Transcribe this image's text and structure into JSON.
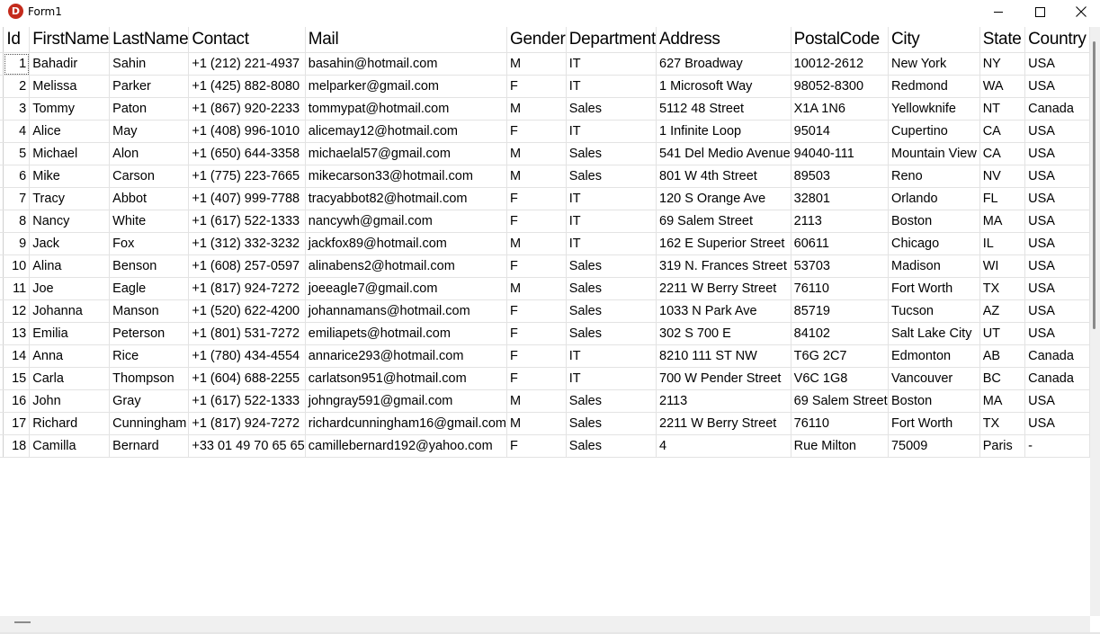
{
  "window": {
    "title": "Form1",
    "app_icon_letter": "D",
    "app_icon_color": "#c42b1c"
  },
  "columns": [
    "Id",
    "FirstName",
    "LastName",
    "Contact",
    "Mail",
    "Gender",
    "Department",
    "Address",
    "PostalCode",
    "City",
    "State",
    "Country"
  ],
  "rows": [
    [
      "1",
      "Bahadir",
      "Sahin",
      "+1 (212) 221-4937",
      "basahin@hotmail.com",
      "M",
      "IT",
      "627 Broadway",
      "10012-2612",
      "New York",
      "NY",
      "USA"
    ],
    [
      "2",
      "Melissa",
      "Parker",
      "+1 (425) 882-8080",
      "melparker@gmail.com",
      "F",
      "IT",
      "1 Microsoft Way",
      "98052-8300",
      "Redmond",
      "WA",
      "USA"
    ],
    [
      "3",
      "Tommy",
      "Paton",
      "+1 (867) 920-2233",
      "tommypat@hotmail.com",
      "M",
      "Sales",
      "5112 48 Street",
      "X1A 1N6",
      "Yellowknife",
      "NT",
      "Canada"
    ],
    [
      "4",
      "Alice",
      "May",
      "+1 (408) 996-1010",
      "alicemay12@hotmail.com",
      "F",
      "IT",
      "1 Infinite Loop",
      "95014",
      "Cupertino",
      "CA",
      "USA"
    ],
    [
      "5",
      "Michael",
      "Alon",
      "+1 (650) 644-3358",
      "michaelal57@gmail.com",
      "M",
      "Sales",
      "541 Del Medio Avenue",
      "94040-111",
      "Mountain View",
      "CA",
      "USA"
    ],
    [
      "6",
      "Mike",
      "Carson",
      "+1 (775) 223-7665",
      "mikecarson33@hotmail.com",
      "M",
      "Sales",
      "801 W 4th Street",
      "89503",
      "Reno",
      "NV",
      "USA"
    ],
    [
      "7",
      "Tracy",
      "Abbot",
      "+1 (407) 999-7788",
      "tracyabbot82@hotmail.com",
      "F",
      "IT",
      "120 S Orange Ave",
      "32801",
      "Orlando",
      "FL",
      "USA"
    ],
    [
      "8",
      "Nancy",
      "White",
      "+1 (617) 522-1333",
      "nancywh@gmail.com",
      "F",
      "IT",
      "69 Salem Street",
      "2113",
      "Boston",
      "MA",
      "USA"
    ],
    [
      "9",
      "Jack",
      "Fox",
      "+1 (312) 332-3232",
      "jackfox89@hotmail.com",
      "M",
      "IT",
      "162 E Superior Street",
      "60611",
      "Chicago",
      "IL",
      "USA"
    ],
    [
      "10",
      "Alina",
      "Benson",
      "+1 (608) 257-0597",
      "alinabens2@hotmail.com",
      "F",
      "Sales",
      "319 N. Frances Street",
      "53703",
      "Madison",
      "WI",
      "USA"
    ],
    [
      "11",
      "Joe",
      "Eagle",
      "+1 (817) 924-7272",
      "joeeagle7@gmail.com",
      "M",
      "Sales",
      "2211 W Berry Street",
      "76110",
      "Fort Worth",
      "TX",
      "USA"
    ],
    [
      "12",
      "Johanna",
      "Manson",
      "+1 (520) 622-4200",
      "johannamans@hotmail.com",
      "F",
      "Sales",
      "1033 N Park Ave",
      "85719",
      "Tucson",
      "AZ",
      "USA"
    ],
    [
      "13",
      "Emilia",
      "Peterson",
      "+1 (801) 531-7272",
      "emiliapets@hotmail.com",
      "F",
      "Sales",
      "302 S 700 E",
      "84102",
      "Salt Lake City",
      "UT",
      "USA"
    ],
    [
      "14",
      "Anna",
      "Rice",
      "+1 (780) 434-4554",
      "annarice293@hotmail.com",
      "F",
      "IT",
      "8210 111 ST NW",
      "T6G 2C7",
      "Edmonton",
      "AB",
      "Canada"
    ],
    [
      "15",
      "Carla",
      "Thompson",
      "+1 (604) 688-2255",
      "carlatson951@hotmail.com",
      "F",
      "IT",
      "700 W Pender Street",
      "V6C 1G8",
      "Vancouver",
      "BC",
      "Canada"
    ],
    [
      "16",
      "John",
      "Gray",
      "+1 (617) 522-1333",
      "johngray591@gmail.com",
      "M",
      "Sales",
      "2113",
      "69 Salem Street",
      "Boston",
      "MA",
      "USA"
    ],
    [
      "17",
      "Richard",
      "Cunningham",
      "+1 (817) 924-7272",
      "richardcunningham16@gmail.com",
      "M",
      "Sales",
      "2211 W Berry Street",
      "76110",
      "Fort Worth",
      "TX",
      "USA"
    ],
    [
      "18",
      "Camilla",
      "Bernard",
      "+33 01 49 70 65 65",
      "camillebernard192@yahoo.com",
      "F",
      "Sales",
      "4",
      " Rue Milton",
      "75009",
      "Paris",
      "-"
    ]
  ],
  "current_row_index": 0
}
